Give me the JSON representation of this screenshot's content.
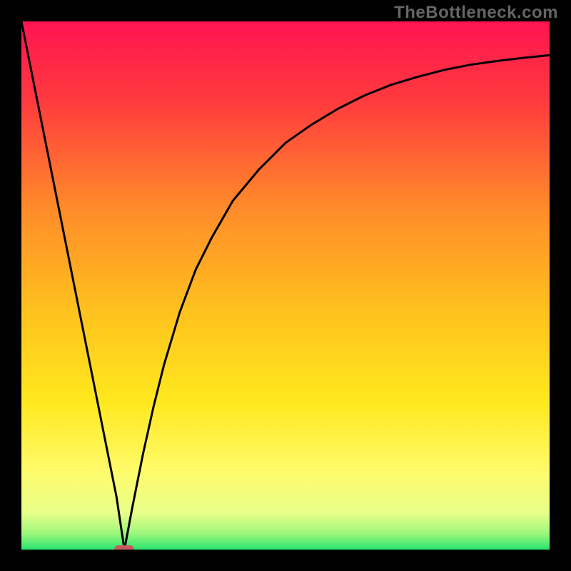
{
  "watermark": "TheBottleneck.com",
  "chart_data": {
    "type": "line",
    "title": "",
    "xlabel": "",
    "ylabel": "",
    "xlim": [
      0,
      100
    ],
    "ylim": [
      0,
      100
    ],
    "grid": false,
    "legend": false,
    "series": [
      {
        "name": "curve",
        "x": [
          0,
          2,
          4,
          6,
          8,
          10,
          12,
          14,
          16,
          18,
          19.5,
          21,
          23,
          25,
          27,
          30,
          33,
          36,
          40,
          45,
          50,
          55,
          60,
          65,
          70,
          75,
          80,
          85,
          90,
          95,
          100
        ],
        "y": [
          100,
          90,
          80,
          70,
          60,
          50,
          40,
          30,
          20,
          10,
          0,
          8,
          18,
          27,
          35,
          45,
          53,
          59,
          66,
          72,
          77,
          80.5,
          83.5,
          86,
          88,
          89.5,
          90.8,
          91.8,
          92.5,
          93.1,
          93.6
        ]
      }
    ],
    "marker": {
      "x": 19.5,
      "y": 0,
      "color": "#c75a5f"
    },
    "background_gradient": {
      "stops": [
        {
          "pct": 0,
          "color": "#ff1450"
        },
        {
          "pct": 15,
          "color": "#ff3a3e"
        },
        {
          "pct": 35,
          "color": "#ff8a2a"
        },
        {
          "pct": 55,
          "color": "#ffc21e"
        },
        {
          "pct": 72,
          "color": "#ffe81e"
        },
        {
          "pct": 85,
          "color": "#fffb6a"
        },
        {
          "pct": 93,
          "color": "#e9ff8a"
        },
        {
          "pct": 97,
          "color": "#9cf77c"
        },
        {
          "pct": 100,
          "color": "#28e46e"
        }
      ]
    }
  }
}
